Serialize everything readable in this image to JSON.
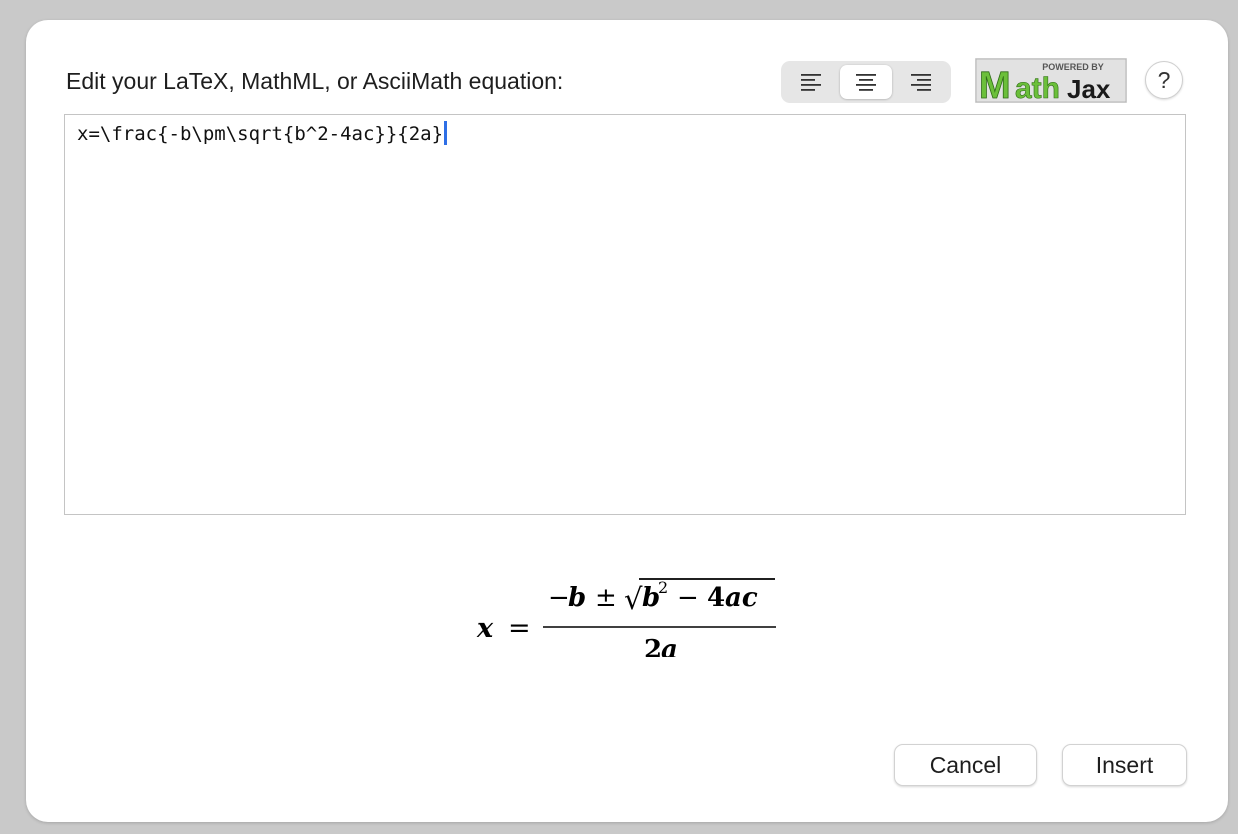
{
  "dialog": {
    "prompt": "Edit your LaTeX, MathML, or AsciiMath equation:",
    "alignment": {
      "options": [
        "left",
        "center",
        "right"
      ],
      "selected": "center"
    },
    "badge": {
      "line1": "POWERED BY",
      "brand_m": "M",
      "brand_ath": "ath",
      "brand_jax": "Jax"
    },
    "help_label": "?",
    "editor_value": "x=\\frac{-b\\pm\\sqrt{b^2-4ac}}{2a}",
    "preview": {
      "lhs": "x",
      "equals": "=",
      "neg": "−",
      "b": "b",
      "pm": "±",
      "sqrt_sign": "√",
      "b2": "b",
      "exp": "2",
      "minus": "−",
      "four": "4",
      "ac": "ac",
      "den_two": "2",
      "den_a": "a"
    },
    "buttons": {
      "cancel": "Cancel",
      "insert": "Insert"
    },
    "colors": {
      "badge_green": "#6bbf3a",
      "badge_dark": "#1a1a1a",
      "caret": "#2e6fe6"
    }
  }
}
